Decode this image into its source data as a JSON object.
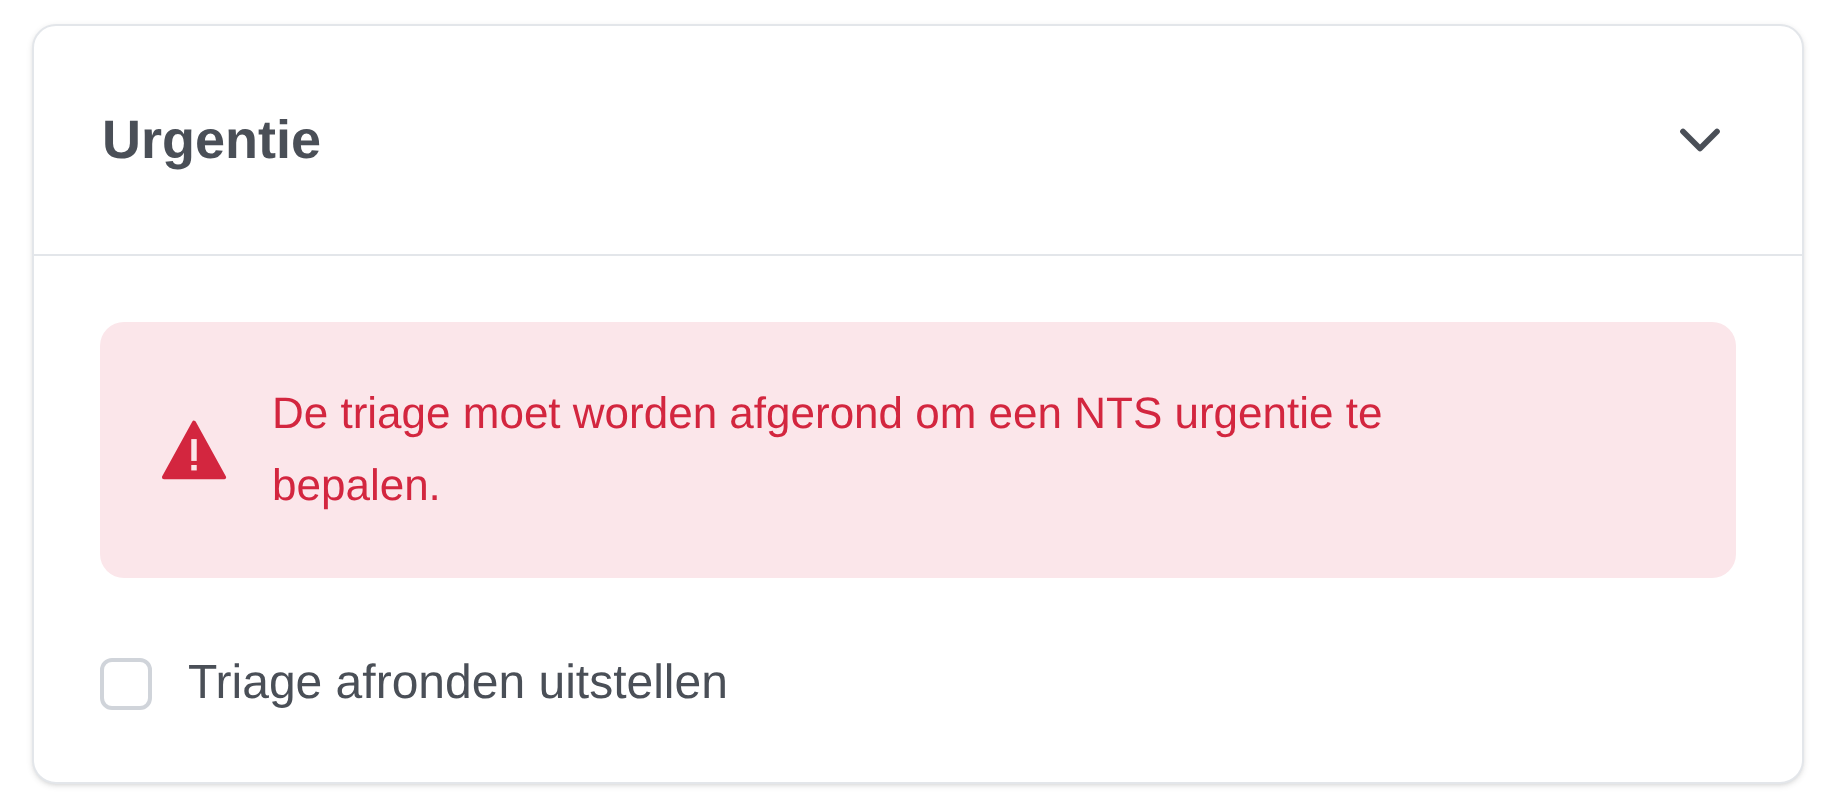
{
  "panel": {
    "title": "Urgentie",
    "expanded": true
  },
  "alert": {
    "message": "De triage moet worden afgerond om een NTS urgentie te bepalen."
  },
  "checkbox": {
    "label": "Triage afronden uitstellen",
    "checked": false
  }
}
